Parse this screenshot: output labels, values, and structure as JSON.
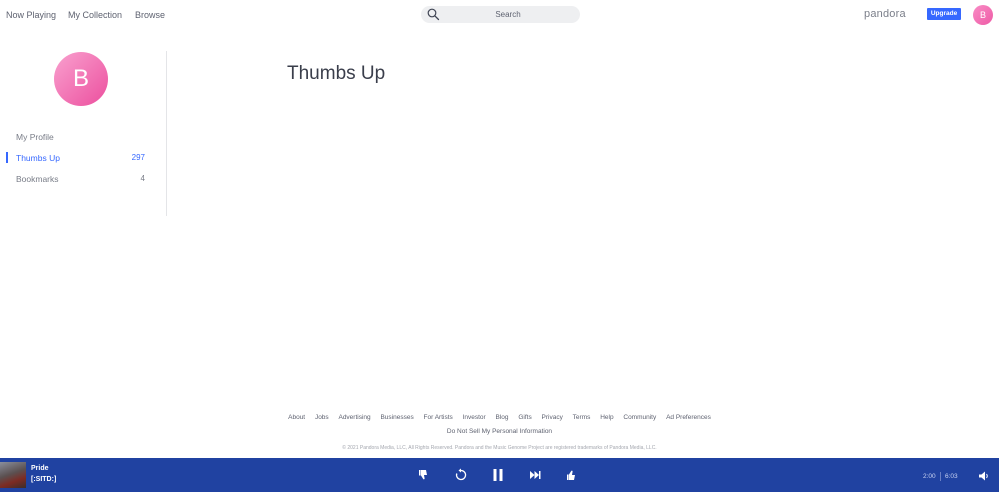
{
  "nav": {
    "now_playing": "Now Playing",
    "my_collection": "My Collection",
    "browse": "Browse"
  },
  "search": {
    "placeholder": "Search"
  },
  "brand": {
    "logo": "pandora",
    "upgrade": "Upgrade",
    "avatar_initial": "B"
  },
  "sidebar": {
    "avatar_initial": "B",
    "items": [
      {
        "label": "My Profile",
        "count": ""
      },
      {
        "label": "Thumbs Up",
        "count": "297"
      },
      {
        "label": "Bookmarks",
        "count": "4"
      }
    ]
  },
  "main": {
    "title": "Thumbs Up"
  },
  "footer": {
    "links": [
      "About",
      "Jobs",
      "Advertising",
      "Businesses",
      "For Artists",
      "Investor",
      "Blog",
      "Gifts",
      "Privacy",
      "Terms",
      "Help",
      "Community",
      "Ad Preferences"
    ],
    "do_not_sell": "Do Not Sell My Personal Information",
    "copyright": "© 2021 Pandora Media, LLC, All Rights Reserved. Pandora and the Music Genome Project are registered trademarks of Pandora Media, LLC."
  },
  "player": {
    "track_title": "Pride",
    "artist": "[:SITD:]",
    "elapsed": "2:00",
    "duration": "6:03",
    "icons": [
      "thumbs-down-icon",
      "replay-icon",
      "pause-icon",
      "skip-icon",
      "thumbs-up-icon",
      "volume-icon"
    ]
  },
  "colors": {
    "accent": "#3668ff",
    "player_bg": "#2042a1",
    "avatar_pink": "#ee5aa5"
  }
}
